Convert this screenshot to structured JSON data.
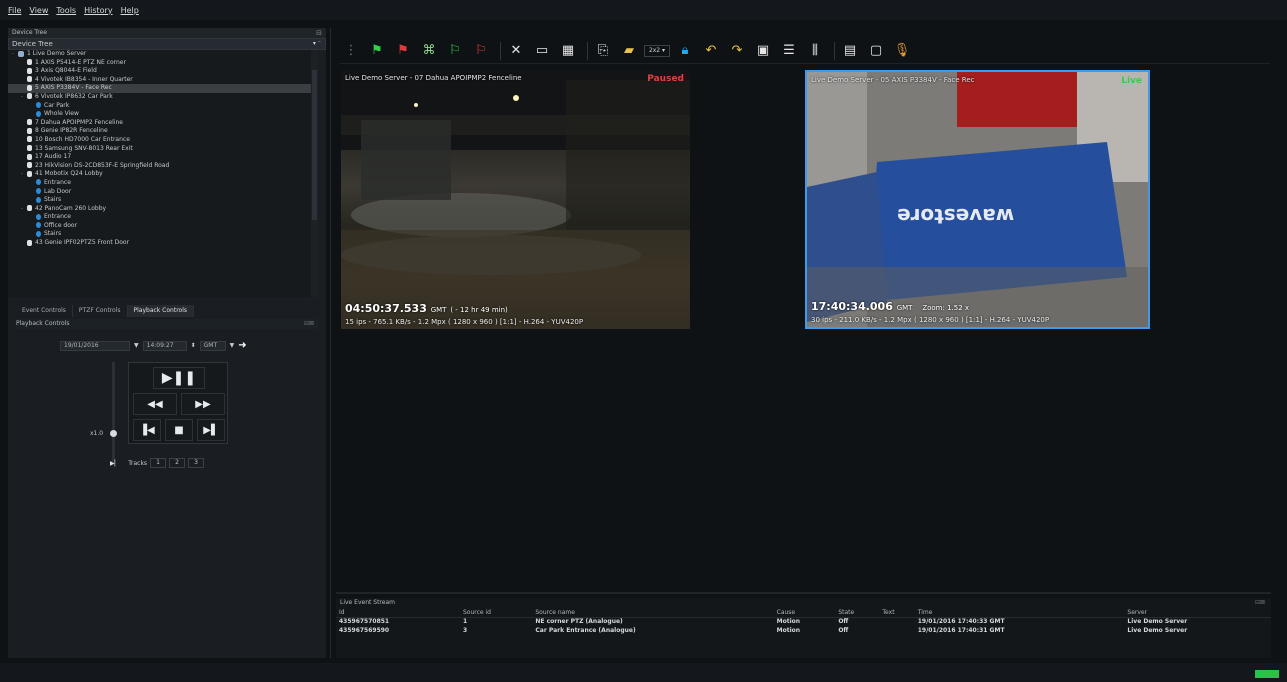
{
  "menu": [
    "File",
    "View",
    "Tools",
    "History",
    "Help"
  ],
  "device_tree": {
    "panel_title": "Device Tree",
    "dropdown_value": "Device Tree",
    "items": [
      {
        "label": "1 Live Demo Server",
        "indent": 1,
        "icon": "server",
        "expander": "-"
      },
      {
        "label": "1 AXIS P5414-E PTZ NE corner",
        "indent": 2,
        "icon": "cam"
      },
      {
        "label": "3 Axis Q8044-E Field",
        "indent": 2,
        "icon": "cam"
      },
      {
        "label": "4 Vivotek IB8354 - Inner Quarter",
        "indent": 2,
        "icon": "cam"
      },
      {
        "label": "5 AXIS P3384V - Face Rec",
        "indent": 2,
        "icon": "cam",
        "selected": true
      },
      {
        "label": "6 Vivotek IP8632 Car Park",
        "indent": 2,
        "icon": "cam",
        "expander": "-"
      },
      {
        "label": "Car Park",
        "indent": 3,
        "icon": "blue"
      },
      {
        "label": "Whole View",
        "indent": 3,
        "icon": "blue"
      },
      {
        "label": "7 Dahua APOIPMP2 Fenceline",
        "indent": 2,
        "icon": "cam"
      },
      {
        "label": "8 Genie IP82R Fenceline",
        "indent": 2,
        "icon": "cam"
      },
      {
        "label": "10 Bosch HD7000 Car Entrance",
        "indent": 2,
        "icon": "cam"
      },
      {
        "label": "13 Samsung SNV-8013 Rear Exit",
        "indent": 2,
        "icon": "cam"
      },
      {
        "label": "17 Audio 17",
        "indent": 2,
        "icon": "cam"
      },
      {
        "label": "23 HikVision DS-2CD853F-E Springfield Road",
        "indent": 2,
        "icon": "cam"
      },
      {
        "label": "41 Mobotix Q24 Lobby",
        "indent": 2,
        "icon": "cam",
        "expander": "-"
      },
      {
        "label": "Entrance",
        "indent": 3,
        "icon": "blue"
      },
      {
        "label": "Lab Door",
        "indent": 3,
        "icon": "blue"
      },
      {
        "label": "Stairs",
        "indent": 3,
        "icon": "blue"
      },
      {
        "label": "42 PanoCam 260 Lobby",
        "indent": 2,
        "icon": "cam",
        "expander": "-"
      },
      {
        "label": "Entrance",
        "indent": 3,
        "icon": "blue"
      },
      {
        "label": "Office door",
        "indent": 3,
        "icon": "blue"
      },
      {
        "label": "Stairs",
        "indent": 3,
        "icon": "blue"
      },
      {
        "label": "43 Genie IPF02PTZ5 Front Door",
        "indent": 2,
        "icon": "cam"
      }
    ]
  },
  "tabs": [
    "Event Controls",
    "PTZF Controls",
    "Playback Controls"
  ],
  "playback": {
    "panel_title": "Playback Controls",
    "date": "19/01/2016",
    "time": "14:09:27",
    "tz": "GMT",
    "speed": "x1.0",
    "play_pause": "▶❚❚",
    "rewind": "◀◀",
    "fast_forward": "▶▶",
    "prev": "▐◀",
    "stop": "■",
    "next": "▶▌",
    "tracks_label": "Tracks",
    "tracks": [
      "1",
      "2",
      "3"
    ]
  },
  "toolbar_icons": [
    "green-flag",
    "red-flag",
    "tree-icon",
    "green-flag-down",
    "red-flag-down",
    "fullscreen",
    "monitor",
    "grid-monitor",
    "box-open",
    "folder-open",
    "layout-2x2",
    "lock",
    "undo",
    "redo",
    "snapshot",
    "settings-panel",
    "equalizer",
    "window",
    "rounded-window",
    "microphone"
  ],
  "layout_select": "2x2",
  "video1": {
    "title": "Live Demo Server - 07 Dahua APOIPMP2 Fenceline",
    "status": "Paused",
    "time": "04:50:37.533",
    "tz": "GMT",
    "offset": "( - 12 hr 49 min)",
    "info": "15 ips  -  765.1 KB/s  -  1.2 Mpx  ( 1280 x 960 ) [1:1]  -  H.264  -  YUV420P"
  },
  "video2": {
    "title": "Live Demo Server - 05 AXIS P3384V - Face Rec",
    "status": "Live",
    "time": "17:40:34.006",
    "tz": "GMT",
    "zoom": "Zoom: 1.52 x",
    "info": "30 ips  -  211.0 KB/s  -  1.2 Mpx  ( 1280 x 960 ) [1:1]  -  H.264  -  YUV420P",
    "rug_text": "wavestore"
  },
  "event_stream": {
    "title": "Live Event Stream",
    "columns": [
      "Id",
      "Source id",
      "Source name",
      "Cause",
      "State",
      "Text",
      "Time",
      "Server"
    ],
    "rows": [
      [
        "435967570851",
        "1",
        "NE corner PTZ (Analogue)",
        "Motion",
        "Off",
        "",
        "19/01/2016 17:40:33 GMT",
        "Live Demo Server"
      ],
      [
        "435967569590",
        "3",
        "Car Park Entrance (Analogue)",
        "Motion",
        "Off",
        "",
        "19/01/2016 17:40:31 GMT",
        "Live Demo Server"
      ]
    ]
  },
  "colors": {
    "accent": "#3d9be9",
    "live": "#2fd04a",
    "paused": "#e04040",
    "status_green": "#29c24a"
  }
}
